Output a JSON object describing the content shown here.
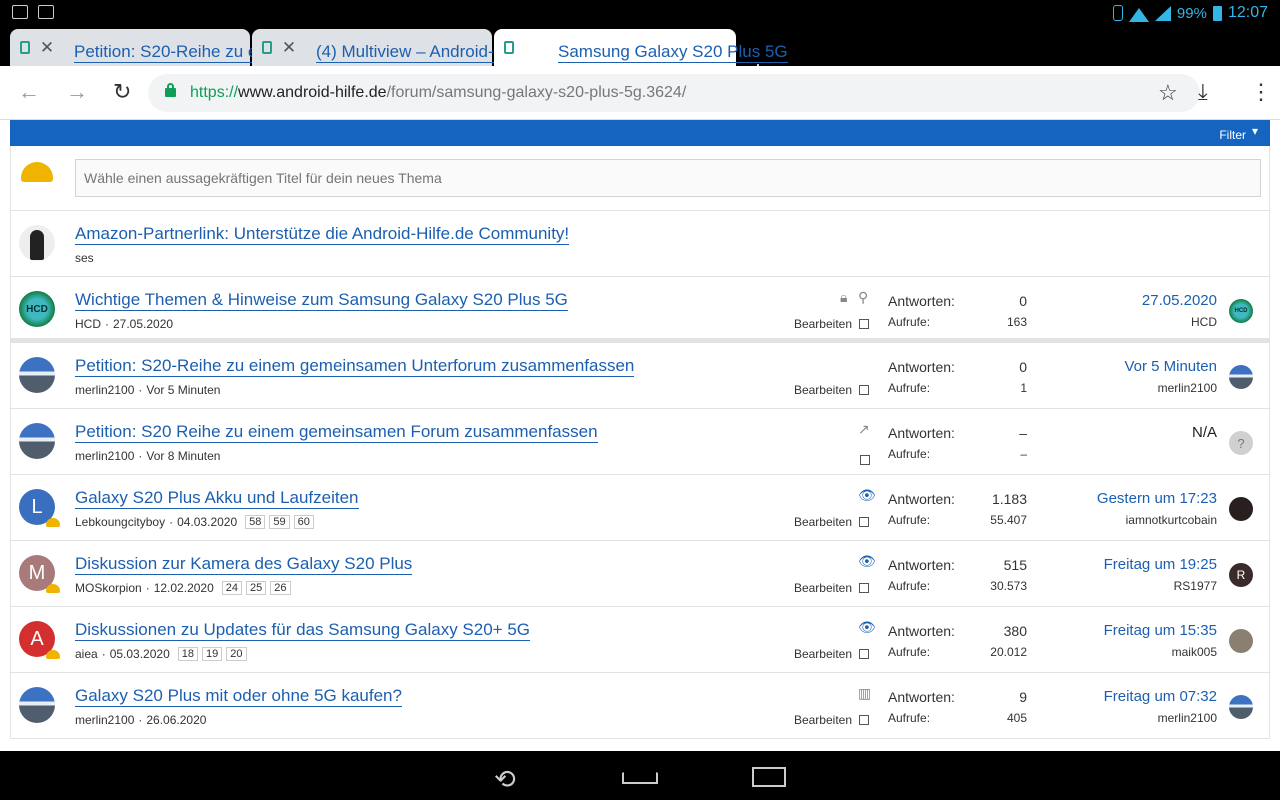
{
  "status": {
    "battery": "99%",
    "time": "12:07"
  },
  "tabs": [
    {
      "title": "Petition: S20-Reihe zu einem"
    },
    {
      "title": "(4) Multiview – Android-Hilfe"
    },
    {
      "title": "Samsung Galaxy S20 Plus 5G"
    }
  ],
  "url": {
    "scheme": "https://",
    "domain": "www.android-hilfe.de",
    "path": "/forum/samsung-galaxy-s20-plus-5g.3624/"
  },
  "filter_label": "Filter",
  "new_thread_placeholder": "Wähle einen aussagekräftigen Titel für dein neues Thema",
  "labels": {
    "replies": "Antworten:",
    "views": "Aufrufe:",
    "edit": "Bearbeiten"
  },
  "sticky": [
    {
      "title": "Amazon-Partnerlink: Unterstütze die Android-Hilfe.de Community!",
      "author": "ses"
    },
    {
      "title": "Wichtige Themen & Hinweise zum Samsung Galaxy S20 Plus 5G",
      "author": "HCD",
      "date": "27.05.2020",
      "replies": "0",
      "views": "163",
      "last_date": "27.05.2020",
      "last_user": "HCD",
      "avatar_text": "HCD"
    }
  ],
  "threads": [
    {
      "title": "Petition: S20-Reihe zu einem gemeinsamen Unterforum zusammenfassen",
      "author": "merlin2100",
      "date": "Vor 5 Minuten",
      "replies": "0",
      "views": "1",
      "last_date": "Vor 5 Minuten",
      "last_user": "merlin2100"
    },
    {
      "title": "Petition: S20 Reihe zu einem gemeinsamen Forum zusammenfassen",
      "author": "merlin2100",
      "date": "Vor 8 Minuten",
      "replies": "–",
      "views": "–",
      "last_date": "N/A",
      "last_user": "",
      "last_avatar": "?"
    },
    {
      "title": "Galaxy S20 Plus Akku und Laufzeiten",
      "author": "Lebkoungcityboy",
      "date": "04.03.2020",
      "pages": [
        "58",
        "59",
        "60"
      ],
      "replies": "1.183",
      "views": "55.407",
      "last_date": "Gestern um 17:23",
      "last_user": "iamnotkurtcobain",
      "avatar_letter": "L",
      "avatar_color": "#3a6fc0"
    },
    {
      "title": "Diskussion zur Kamera des Galaxy S20 Plus",
      "author": "MOSkorpion",
      "date": "12.02.2020",
      "pages": [
        "24",
        "25",
        "26"
      ],
      "replies": "515",
      "views": "30.573",
      "last_date": "Freitag um 19:25",
      "last_user": "RS1977",
      "avatar_letter": "M",
      "avatar_color": "#a87a7a",
      "last_avatar": "R"
    },
    {
      "title": "Diskussionen zu Updates für das Samsung Galaxy S20+ 5G",
      "author": "aiea",
      "date": "05.03.2020",
      "pages": [
        "18",
        "19",
        "20"
      ],
      "replies": "380",
      "views": "20.012",
      "last_date": "Freitag um 15:35",
      "last_user": "maik005",
      "avatar_letter": "A",
      "avatar_color": "#d32f2f"
    },
    {
      "title": "Galaxy S20 Plus mit oder ohne 5G kaufen?",
      "author": "merlin2100",
      "date": "26.06.2020",
      "replies": "9",
      "views": "405",
      "last_date": "Freitag um 07:32",
      "last_user": "merlin2100"
    }
  ]
}
